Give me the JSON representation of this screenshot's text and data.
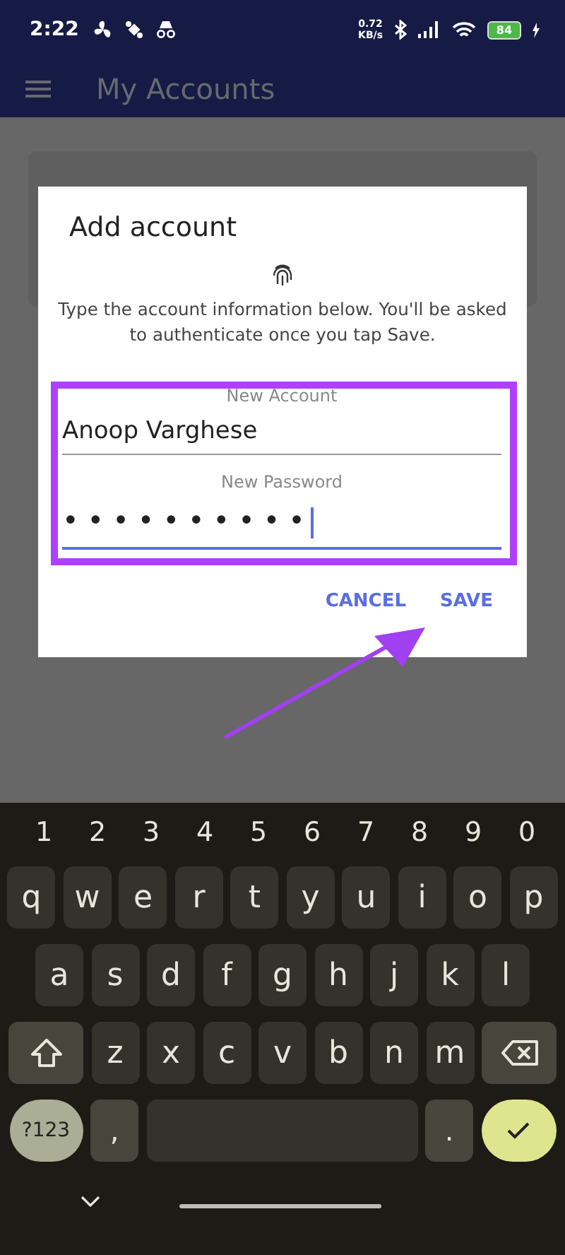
{
  "status_bar": {
    "time": "2:22",
    "net_speed": "0.72",
    "net_unit": "KB/s",
    "battery": "84"
  },
  "app_bar": {
    "title": "My Accounts"
  },
  "dialog": {
    "title": "Add account",
    "message": "Type the account information below. You'll be asked to authenticate once you tap Save.",
    "fields": [
      {
        "label": "New Account",
        "value": "Anoop Varghese",
        "focused": false
      },
      {
        "label": "New Password",
        "value": "••••••••••",
        "focused": true
      }
    ],
    "buttons": [
      {
        "label": "CANCEL"
      },
      {
        "label": "SAVE"
      }
    ]
  },
  "keyboard": {
    "number_row": [
      "1",
      "2",
      "3",
      "4",
      "5",
      "6",
      "7",
      "8",
      "9",
      "0"
    ],
    "rows": [
      {
        "keys": [
          {
            "kind": "letter",
            "label": "q"
          },
          {
            "kind": "letter",
            "label": "w"
          },
          {
            "kind": "letter",
            "label": "e"
          },
          {
            "kind": "letter",
            "label": "r"
          },
          {
            "kind": "letter",
            "label": "t"
          },
          {
            "kind": "letter",
            "label": "y"
          },
          {
            "kind": "letter",
            "label": "u"
          },
          {
            "kind": "letter",
            "label": "i"
          },
          {
            "kind": "letter",
            "label": "o"
          },
          {
            "kind": "letter",
            "label": "p"
          }
        ]
      },
      {
        "keys": [
          {
            "kind": "letter",
            "label": "a"
          },
          {
            "kind": "letter",
            "label": "s"
          },
          {
            "kind": "letter",
            "label": "d"
          },
          {
            "kind": "letter",
            "label": "f"
          },
          {
            "kind": "letter",
            "label": "g"
          },
          {
            "kind": "letter",
            "label": "h"
          },
          {
            "kind": "letter",
            "label": "j"
          },
          {
            "kind": "letter",
            "label": "k"
          },
          {
            "kind": "letter",
            "label": "l"
          }
        ]
      },
      {
        "keys": [
          {
            "kind": "shift"
          },
          {
            "kind": "letter",
            "label": "z"
          },
          {
            "kind": "letter",
            "label": "x"
          },
          {
            "kind": "letter",
            "label": "c"
          },
          {
            "kind": "letter",
            "label": "v"
          },
          {
            "kind": "letter",
            "label": "b"
          },
          {
            "kind": "letter",
            "label": "n"
          },
          {
            "kind": "letter",
            "label": "m"
          },
          {
            "kind": "backspace"
          }
        ]
      },
      {
        "keys": [
          {
            "kind": "symbols",
            "label": "?123"
          },
          {
            "kind": "comma",
            "label": ","
          },
          {
            "kind": "space"
          },
          {
            "kind": "period",
            "label": "."
          },
          {
            "kind": "enter"
          }
        ]
      }
    ]
  }
}
